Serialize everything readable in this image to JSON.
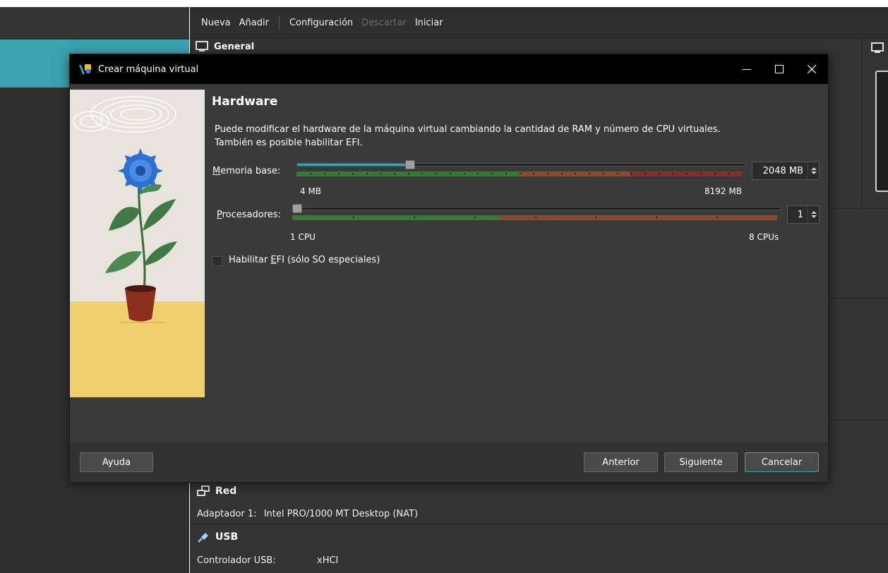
{
  "manager": {
    "toolbar": {
      "new": "Nueva",
      "add": "Añadir",
      "settings": "Configuración",
      "discard": "Descartar",
      "start": "Iniciar"
    },
    "details": {
      "general_title": "General",
      "network_title": "Red",
      "network_adapter_label": "Adaptador 1:",
      "network_adapter_value": "Intel PRO/1000 MT Desktop (NAT)",
      "usb_title": "USB",
      "usb_controller_label": "Controlador USB:",
      "usb_controller_value": "xHCI"
    }
  },
  "dialog": {
    "title": "Crear máquina virtual",
    "window_controls": [
      "minimize-icon",
      "maximize-icon",
      "close-icon"
    ],
    "heading": "Hardware",
    "description": "Puede modificar el hardware de la máquina virtual cambiando la cantidad de RAM y número de CPU virtuales. También es posible habilitar EFI.",
    "memory": {
      "label_accel": "M",
      "label_rest": "emoria base:",
      "value": "2048 MB",
      "min_label": "4 MB",
      "max_label": "8192 MB",
      "min": 4,
      "max": 8192,
      "current": 2048,
      "recommended_until": 4096,
      "warning_until": 6144
    },
    "cpu": {
      "label_accel": "P",
      "label_rest": "rocesadores:",
      "value": "1",
      "min_label": "1 CPU",
      "max_label": "8 CPUs",
      "min": 1,
      "max": 8,
      "current": 1,
      "recommended_until": 4
    },
    "efi": {
      "label_pre": "Habilitar ",
      "label_accel": "E",
      "label_post": "FI (sólo SO especiales)",
      "checked": false
    },
    "buttons": {
      "help": "Ayuda",
      "back": "Anterior",
      "next": "Siguiente",
      "cancel": "Cancelar"
    },
    "colors": {
      "accent": "#3ba2b0",
      "ok": "#2e7d32",
      "warn": "#8b4a2b",
      "danger": "#8b2b2b"
    }
  }
}
